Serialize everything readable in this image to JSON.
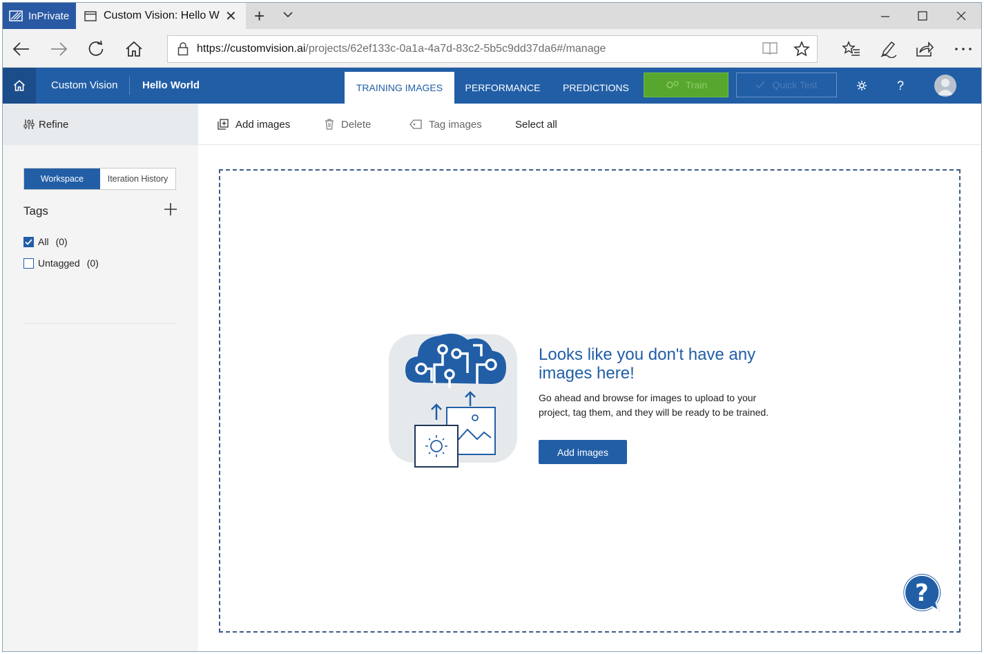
{
  "browser": {
    "inprivate_label": "InPrivate",
    "tab_title": "Custom Vision: Hello W",
    "url_host": "https://customvision.ai",
    "url_path": "/projects/62ef133c-0a1a-4a7d-83c2-5b5c9dd37da6#/manage",
    "icons": [
      "inprivate-icon",
      "tab-page-icon",
      "close-icon",
      "plus-icon",
      "chevron-down-icon",
      "minimize-icon",
      "maximize-icon",
      "close-window-icon",
      "back-arrow-icon",
      "forward-arrow-icon",
      "refresh-icon",
      "home-icon",
      "lock-icon",
      "reading-view-icon",
      "star-icon",
      "favorites-icon",
      "pen-icon",
      "share-icon",
      "more-icon"
    ]
  },
  "header": {
    "brand": "Custom Vision",
    "project": "Hello World",
    "tabs": [
      {
        "label": "TRAINING IMAGES",
        "active": true
      },
      {
        "label": "PERFORMANCE",
        "active": false
      },
      {
        "label": "PREDICTIONS",
        "active": false
      }
    ],
    "train_label": "Train",
    "quicktest_label": "Quick Test",
    "accent_color": "#215ea6",
    "train_color": "#57a72f"
  },
  "sidebar": {
    "refine_label": "Refine",
    "segments": [
      "Workspace",
      "Iteration History"
    ],
    "tags_title": "Tags",
    "tags": [
      {
        "label": "All",
        "count": "(0)",
        "checked": true
      },
      {
        "label": "Untagged",
        "count": "(0)",
        "checked": false
      }
    ]
  },
  "toolbar": {
    "add_images": "Add images",
    "delete": "Delete",
    "tag_images": "Tag images",
    "select_all": "Select all"
  },
  "empty_state": {
    "title": "Looks like you don't have any images here!",
    "text": "Go ahead and browse for images to upload to your project, tag them, and they will be ready to be trained.",
    "button": "Add images"
  }
}
